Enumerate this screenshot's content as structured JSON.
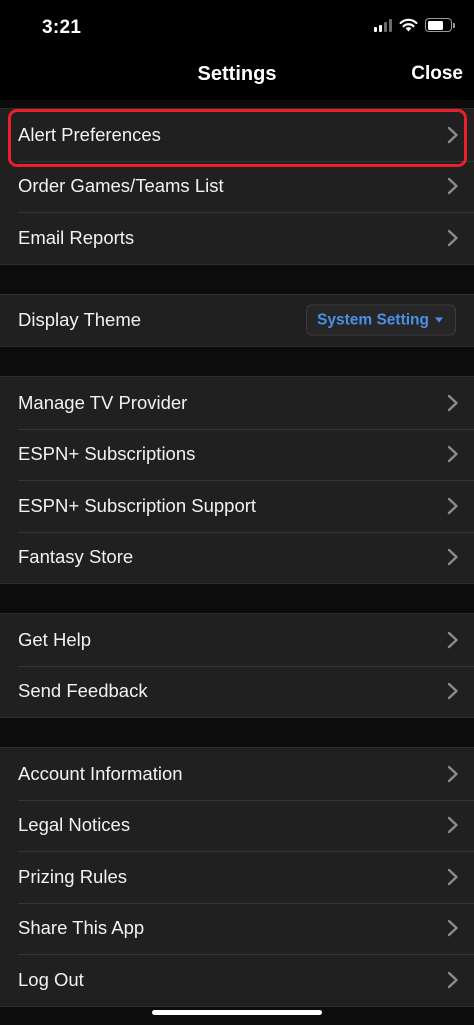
{
  "status_bar": {
    "time": "3:21"
  },
  "nav": {
    "title": "Settings",
    "close_label": "Close"
  },
  "groups": [
    {
      "items": [
        {
          "label": "Alert Preferences"
        },
        {
          "label": "Order Games/Teams List"
        },
        {
          "label": "Email Reports"
        }
      ]
    },
    {
      "items": [
        {
          "label": "Display Theme",
          "value": "System Setting"
        }
      ]
    },
    {
      "items": [
        {
          "label": "Manage TV Provider"
        },
        {
          "label": "ESPN+ Subscriptions"
        },
        {
          "label": "ESPN+ Subscription Support"
        },
        {
          "label": "Fantasy Store"
        }
      ]
    },
    {
      "items": [
        {
          "label": "Get Help"
        },
        {
          "label": "Send Feedback"
        }
      ]
    },
    {
      "items": [
        {
          "label": "Account Information"
        },
        {
          "label": "Legal Notices"
        },
        {
          "label": "Prizing Rules"
        },
        {
          "label": "Share This App"
        },
        {
          "label": "Log Out"
        }
      ]
    }
  ],
  "colors": {
    "accent": "#4a90e8",
    "highlight_border": "#e8202c",
    "row_background": "#202020",
    "page_background": "#0c0c0c"
  },
  "icons": {
    "row_disclosure": "chevron-right-icon",
    "dropdown": "caret-down-icon"
  }
}
